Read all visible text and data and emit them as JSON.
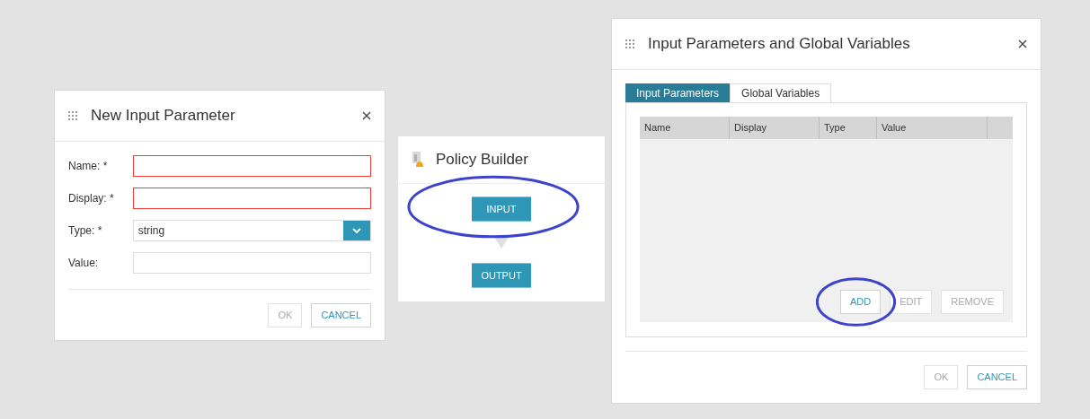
{
  "new_parameter_dialog": {
    "title": "New Input Parameter",
    "fields": [
      {
        "kind": "text",
        "label": "Name: *",
        "invalid": true
      },
      {
        "kind": "text",
        "label": "Display: *",
        "invalid": true
      },
      {
        "kind": "select",
        "label": "Type: *",
        "value": "string",
        "invalid": false
      },
      {
        "kind": "text",
        "label": "Value:",
        "invalid": false
      }
    ],
    "buttons": [
      {
        "label": "OK",
        "disabled": true
      },
      {
        "label": "CANCEL",
        "disabled": false
      }
    ]
  },
  "policy_builder": {
    "title": "Policy Builder",
    "nodes": [
      {
        "label": "INPUT",
        "circled": true
      },
      {
        "label": "OUTPUT",
        "circled": false
      }
    ]
  },
  "variables_dialog": {
    "title": "Input Parameters and Global Variables",
    "tabs": [
      {
        "label": "Input Parameters",
        "selected": true
      },
      {
        "label": "Global Variables",
        "selected": false
      }
    ],
    "table": {
      "columns": [
        "Name",
        "Display",
        "Type",
        "Value"
      ]
    },
    "table_buttons": [
      {
        "label": "ADD",
        "disabled": false,
        "circled": true
      },
      {
        "label": "EDIT",
        "disabled": true,
        "circled": false
      },
      {
        "label": "REMOVE",
        "disabled": true,
        "circled": false
      }
    ],
    "buttons": [
      {
        "label": "OK",
        "disabled": true
      },
      {
        "label": "CANCEL",
        "disabled": false
      }
    ]
  }
}
